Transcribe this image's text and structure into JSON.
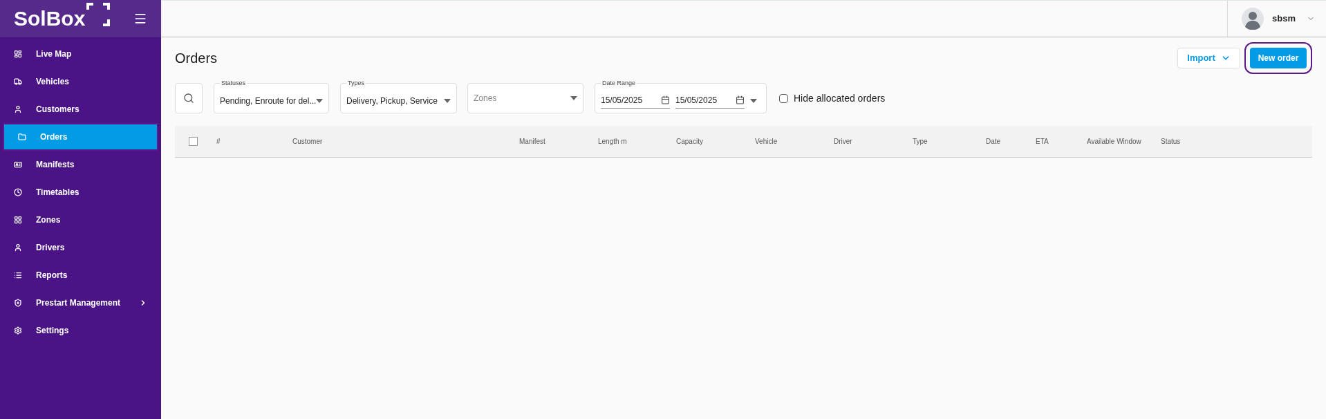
{
  "sidebar": {
    "logo": "SolBox",
    "items": [
      {
        "label": "Live Map",
        "selected": false
      },
      {
        "label": "Vehicles",
        "selected": false
      },
      {
        "label": "Customers",
        "selected": false
      },
      {
        "label": "Orders",
        "selected": true
      },
      {
        "label": "Manifests",
        "selected": false
      },
      {
        "label": "Timetables",
        "selected": false
      },
      {
        "label": "Zones",
        "selected": false
      },
      {
        "label": "Drivers",
        "selected": false
      },
      {
        "label": "Reports",
        "selected": false
      },
      {
        "label": "Prestart Management",
        "selected": false,
        "has_submenu": true
      },
      {
        "label": "Settings",
        "selected": false
      }
    ]
  },
  "user": {
    "name": "sbsm"
  },
  "page": {
    "title": "Orders",
    "import_button": "Import",
    "new_button": "New order"
  },
  "filters": {
    "statuses": {
      "label": "Statuses",
      "value": "Pending, Enroute for del..."
    },
    "types": {
      "label": "Types",
      "value": "Delivery, Pickup, Service"
    },
    "zones": {
      "placeholder": "Zones"
    },
    "date_range": {
      "label": "Date Range",
      "from": "15/05/2025",
      "to": "15/05/2025"
    },
    "hide_allocated": {
      "label": "Hide allocated orders",
      "checked": false
    }
  },
  "table": {
    "select_all_checked": false,
    "columns": [
      "#",
      "Customer",
      "Manifest",
      "Length m",
      "Capacity",
      "Vehicle",
      "Driver",
      "Type",
      "Date",
      "ETA",
      "Available Window",
      "Status"
    ]
  }
}
